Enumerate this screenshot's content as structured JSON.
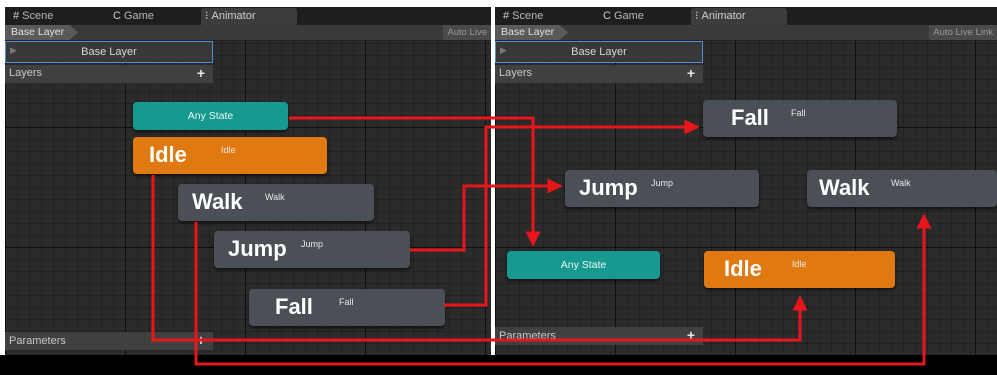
{
  "left": {
    "tabs": [
      {
        "icon": "#",
        "label": "Scene"
      },
      {
        "icon": "C",
        "label": "Game"
      },
      {
        "icon": "⁝",
        "label": "Animator"
      }
    ],
    "breadcrumb": "Base Layer",
    "auto_live": "Auto Live",
    "layer_name": "Base Layer",
    "layers_label": "Layers",
    "params_label": "Parameters",
    "nodes": {
      "any_state": "Any State",
      "idle": {
        "name": "Idle",
        "sub": "Idle"
      },
      "walk": {
        "name": "Walk",
        "sub": "Walk"
      },
      "jump": {
        "name": "Jump",
        "sub": "Jump"
      },
      "fall": {
        "name": "Fall",
        "sub": "Fall"
      }
    }
  },
  "right": {
    "tabs": [
      {
        "icon": "#",
        "label": "Scene"
      },
      {
        "icon": "C",
        "label": "Game"
      },
      {
        "icon": "⁝",
        "label": "Animator"
      }
    ],
    "breadcrumb": "Base Layer",
    "auto_live": "Auto Live Link",
    "layer_name": "Base Layer",
    "layers_label": "Layers",
    "params_label": "Parameters",
    "nodes": {
      "any_state": "Any State",
      "idle": {
        "name": "Idle",
        "sub": "Idle"
      },
      "walk": {
        "name": "Walk",
        "sub": "Walk"
      },
      "jump": {
        "name": "Jump",
        "sub": "Jump"
      },
      "fall": {
        "name": "Fall",
        "sub": "Fall"
      }
    }
  },
  "colors": {
    "arrow": "#e8161b",
    "state_orange": "#e07a10",
    "any_state_teal": "#16998f",
    "state_gray": "#4a5056"
  }
}
